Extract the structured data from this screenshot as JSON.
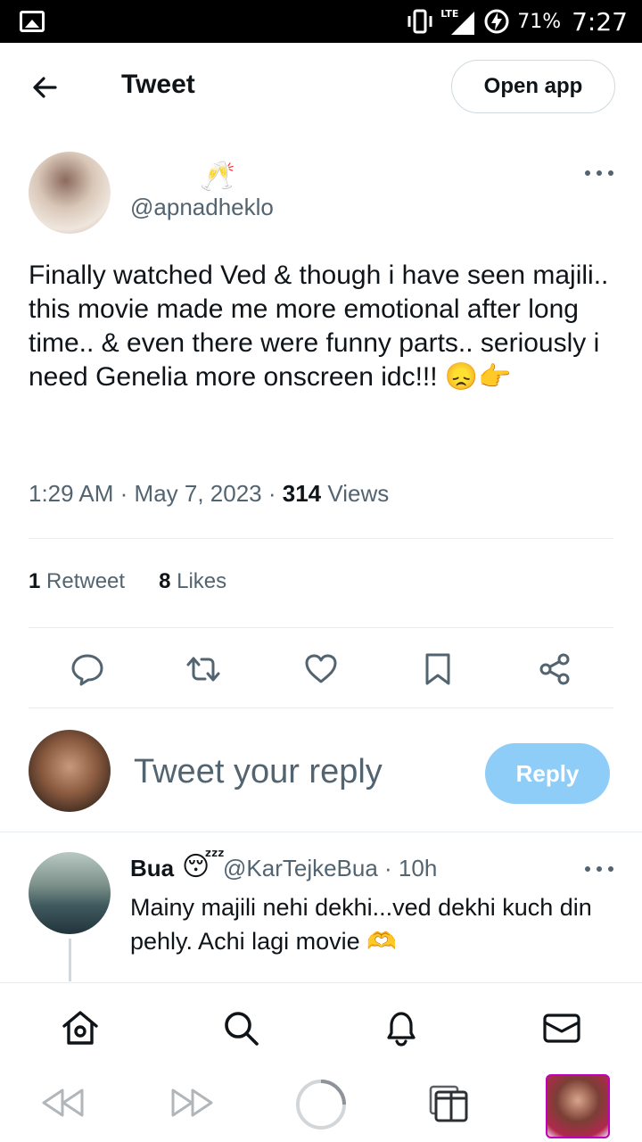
{
  "status_bar": {
    "network": "LTE",
    "battery": "71%",
    "time": "7:27"
  },
  "header": {
    "title": "Tweet",
    "open_app_label": "Open app"
  },
  "tweet": {
    "author_display_emoji": "🥂",
    "author_handle": "@apnadheklo",
    "text": "Finally watched Ved & though i have seen majili.. this movie made me more emotional after long time.. & even there were funny parts.. seriously i need Genelia more onscreen idc!!! 😞👉",
    "time": "1:29 AM",
    "date": "May 7, 2023",
    "views_count": "314",
    "views_label": "Views",
    "retweets_count": "1",
    "retweets_label": "Retweet",
    "likes_count": "8",
    "likes_label": "Likes"
  },
  "composer": {
    "placeholder": "Tweet your reply",
    "reply_label": "Reply"
  },
  "replies": [
    {
      "name": "Bua",
      "emoji": "😴",
      "handle_time": "@KarTejkeBua · 10h",
      "text": "Mainy majili nehi dekhi...ved dekhi kuch din pehly. Achi lagi movie 🫶"
    }
  ],
  "icons": {
    "back": "arrow-left-icon",
    "reply": "comment-icon",
    "retweet": "retweet-icon",
    "like": "heart-icon",
    "bookmark": "bookmark-icon",
    "share": "share-icon",
    "home": "home-icon",
    "search": "search-icon",
    "notifications": "bell-icon",
    "messages": "mail-icon"
  },
  "colors": {
    "accent_disabled": "#8ecdf8",
    "text_secondary": "#536471",
    "text_primary": "#0f1419"
  }
}
